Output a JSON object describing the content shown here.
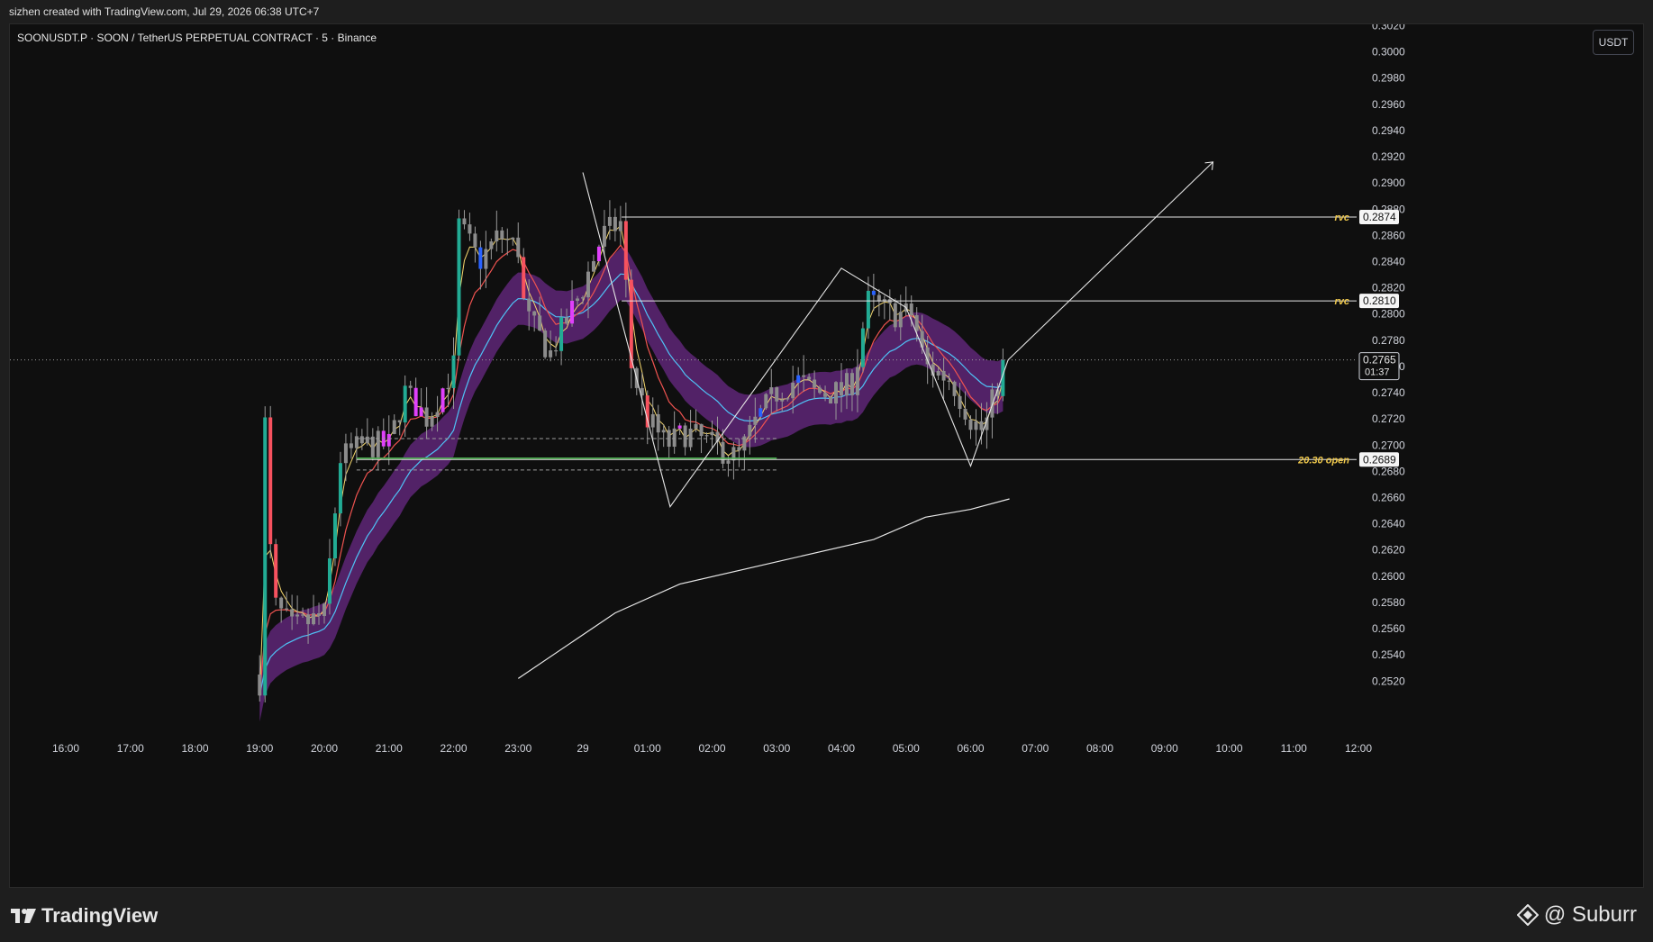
{
  "header": {
    "attribution": "sizhen created with TradingView.com, Jul 29, 2026 06:38 UTC+7"
  },
  "chart": {
    "symbol": "SOONUSDT.P · SOON / TetherUS PERPETUAL CONTRACT · 5 · Binance",
    "currency": "USDT",
    "price_ticks": [
      "0.3020",
      "0.3000",
      "0.2980",
      "0.2960",
      "0.2940",
      "0.2920",
      "0.2900",
      "0.2880",
      "0.2860",
      "0.2840",
      "0.2820",
      "0.2800",
      "0.2780",
      "0.2760",
      "0.2740",
      "0.2720",
      "0.2700",
      "0.2680",
      "0.2660",
      "0.2640",
      "0.2620",
      "0.2600",
      "0.2580",
      "0.2560",
      "0.2540",
      "0.2520"
    ],
    "time_ticks": [
      "16:00",
      "17:00",
      "18:00",
      "19:00",
      "20:00",
      "21:00",
      "22:00",
      "23:00",
      "29",
      "01:00",
      "02:00",
      "03:00",
      "04:00",
      "05:00",
      "06:00",
      "07:00",
      "08:00",
      "09:00",
      "10:00",
      "11:00",
      "12:00"
    ],
    "levels": [
      {
        "tag": "rvc",
        "price": "0.2874"
      },
      {
        "tag": "rvc",
        "price": "0.2810"
      },
      {
        "tag": "20.30 open",
        "price": "0.2689"
      }
    ],
    "current_price": "0.2765",
    "countdown": "01:37"
  },
  "chart_data": {
    "type": "candlestick",
    "y_range": [
      0.2508,
      0.3038
    ],
    "x_range": [
      "16:00",
      "12:00"
    ],
    "grid": false,
    "ohlc_approx": [
      [
        "19:00",
        0.2525,
        0.274,
        0.25,
        0.274
      ],
      [
        "20:00",
        0.257,
        0.271,
        0.254,
        0.269
      ],
      [
        "21:00",
        0.269,
        0.28,
        0.268,
        0.276
      ],
      [
        "22:00",
        0.275,
        0.295,
        0.274,
        0.287
      ],
      [
        "23:00",
        0.285,
        0.291,
        0.273,
        0.279
      ],
      [
        "29",
        0.279,
        0.29,
        0.274,
        0.287
      ],
      [
        "01:00",
        0.287,
        0.288,
        0.267,
        0.268
      ],
      [
        "02:00",
        0.269,
        0.276,
        0.267,
        0.27
      ],
      [
        "03:00",
        0.271,
        0.277,
        0.271,
        0.275
      ],
      [
        "04:00",
        0.275,
        0.282,
        0.274,
        0.281
      ],
      [
        "05:00",
        0.28,
        0.282,
        0.273,
        0.276
      ],
      [
        "06:00",
        0.274,
        0.278,
        0.27,
        0.2765
      ]
    ],
    "colors": {
      "up": "#22ab94",
      "down": "#f7525f",
      "neutral": "#8a8a8a",
      "signal_blue": "#2962ff",
      "signal_magenta": "#e040fb",
      "band": "#6a2a86",
      "ema_fast": "#f5d76e",
      "ema_mid": "#ef5350",
      "ema_band": "#4fc3f7"
    }
  },
  "footer": {
    "brand": "TradingView",
    "author": "@ Suburr"
  }
}
